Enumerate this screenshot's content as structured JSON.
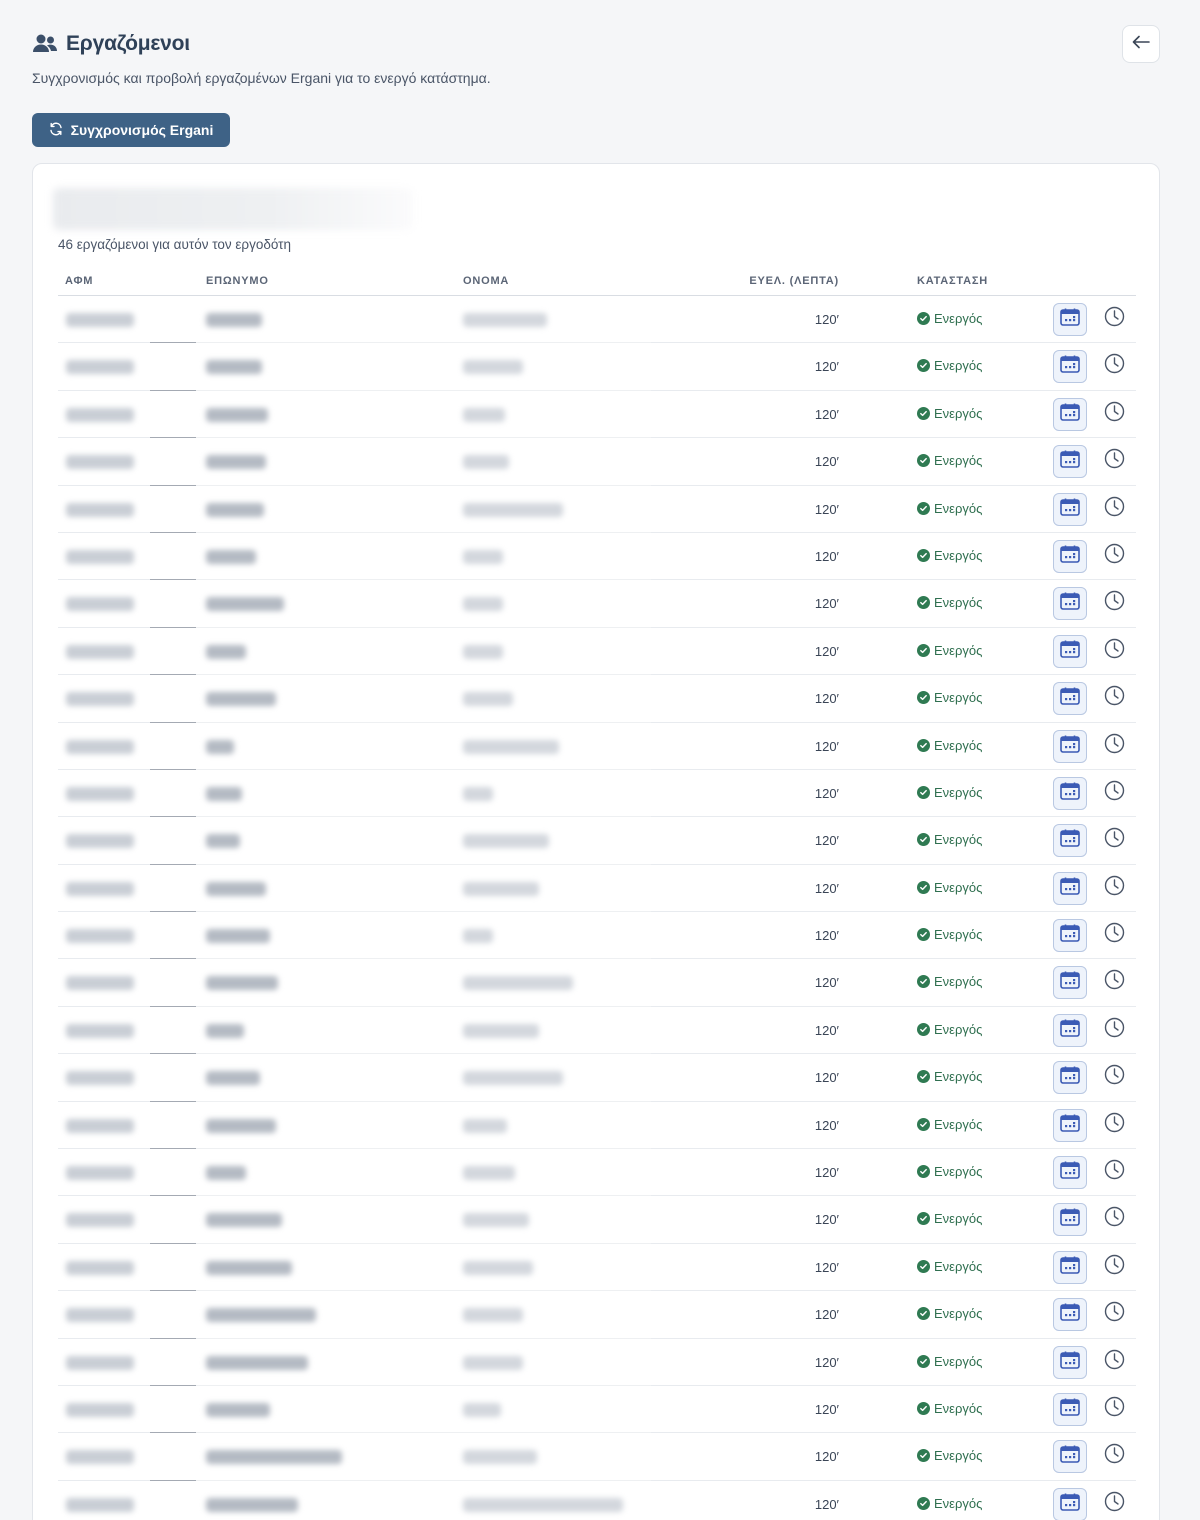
{
  "header": {
    "title": "Εργαζόμενοι",
    "subtitle": "Συγχρονισμός και προβολή εργαζομένων Ergani για το ενεργό κατάστημα.",
    "icon": "users-icon",
    "back_icon": "arrow-left-icon"
  },
  "sync_button": {
    "label": "Συγχρονισμός Ergani",
    "icon": "refresh-icon"
  },
  "card": {
    "employer_count_text": "46 εργαζόμενοι για αυτόν τον εργοδότη"
  },
  "table": {
    "columns": {
      "afm": "ΑΦΜ",
      "surname": "ΕΠΩΝΥΜΟ",
      "name": "ΟΝΟΜΑ",
      "flex": "ΕΥΕΛ. (ΛΕΠΤΑ)",
      "status": "ΚΑΤΑΣΤΑΣΗ"
    },
    "rows": [
      {
        "flex": "120′",
        "status": "Ενεργός"
      },
      {
        "flex": "120′",
        "status": "Ενεργός"
      },
      {
        "flex": "120′",
        "status": "Ενεργός"
      },
      {
        "flex": "120′",
        "status": "Ενεργός"
      },
      {
        "flex": "120′",
        "status": "Ενεργός"
      },
      {
        "flex": "120′",
        "status": "Ενεργός"
      },
      {
        "flex": "120′",
        "status": "Ενεργός"
      },
      {
        "flex": "120′",
        "status": "Ενεργός"
      },
      {
        "flex": "120′",
        "status": "Ενεργός"
      },
      {
        "flex": "120′",
        "status": "Ενεργός"
      },
      {
        "flex": "120′",
        "status": "Ενεργός"
      },
      {
        "flex": "120′",
        "status": "Ενεργός"
      },
      {
        "flex": "120′",
        "status": "Ενεργός"
      },
      {
        "flex": "120′",
        "status": "Ενεργός"
      },
      {
        "flex": "120′",
        "status": "Ενεργός"
      },
      {
        "flex": "120′",
        "status": "Ενεργός"
      },
      {
        "flex": "120′",
        "status": "Ενεργός"
      },
      {
        "flex": "120′",
        "status": "Ενεργός"
      },
      {
        "flex": "120′",
        "status": "Ενεργός"
      },
      {
        "flex": "120′",
        "status": "Ενεργός"
      },
      {
        "flex": "120′",
        "status": "Ενεργός"
      },
      {
        "flex": "120′",
        "status": "Ενεργός"
      },
      {
        "flex": "120′",
        "status": "Ενεργός"
      },
      {
        "flex": "120′",
        "status": "Ενεργός"
      },
      {
        "flex": "120′",
        "status": "Ενεργός"
      },
      {
        "flex": "120′",
        "status": "Ενεργός"
      }
    ],
    "row_icons": {
      "schedule": "calendar-icon",
      "history": "clock-icon",
      "status": "check-circle-icon"
    }
  },
  "colors": {
    "primary_button": "#3e6286",
    "status_green": "#2f7a52",
    "calendar_blue": "#3b5bb5"
  }
}
